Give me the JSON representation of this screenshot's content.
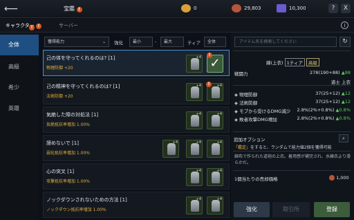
{
  "header": {
    "title": "宝鑑",
    "gold": "0",
    "silver": "29,803",
    "gem": "10,300",
    "help": "?",
    "close": "X"
  },
  "subtabs": [
    "キャラクター",
    "サーバー"
  ],
  "sidebar": [
    "全体",
    "高級",
    "希少",
    "英雄"
  ],
  "filters": {
    "ability": "獲得能力",
    "reinforce_label": "強化",
    "min": "最小",
    "max": "最大",
    "tier_label": "ティア",
    "tier_value": "全体"
  },
  "rows": [
    {
      "name": "己の体を守ってくれるのは? [1]",
      "desc": "物理防御 +20"
    },
    {
      "name": "己の精神を守ってくれるのは? [1]",
      "desc": "法術防御 +20"
    },
    {
      "name": "気絶した際の対処法 [1]",
      "desc": "気絶抵抗率増加 1.00%"
    },
    {
      "name": "諦めないで [1]",
      "desc": "弱化抵抗率増加 1.00%"
    },
    {
      "name": "心の突叉 [1]",
      "desc": "攻撃抵抗率増加 1.00%"
    },
    {
      "name": "ノックダウンされないための方法 [1]",
      "desc": "ノックダウン抵抗率増加 1.00%"
    }
  ],
  "detail": {
    "search_placeholder": "アイテム名を検索してください",
    "item_name": "綿(上衣)",
    "tier_tag": "1ティア",
    "grade_tag": "高級",
    "power_label": "戦闘力",
    "power_value": "278(190+88)",
    "power_up": "▲88",
    "type": "道士 上衣",
    "stats": [
      {
        "label": "物理防御",
        "value": "37(25+12)",
        "up": "▲12"
      },
      {
        "label": "法術防御",
        "value": "37(25+12)",
        "up": "▲12"
      },
      {
        "label": "モブから受けるDMG減少",
        "value": "2.8%(2%+0.8%)",
        "up": "▲0.8%"
      },
      {
        "label": "敗者攻撃DMG増加",
        "value": "2.8%(2%+0.8%)",
        "up": "▲0.8%"
      }
    ],
    "option_title": "追加オプション",
    "option_desc_hl": "「鑑定」",
    "option_desc": "をすると、ランダムで能力値2個を獲得可能",
    "flavor": "綿布で作られた道袍の上衣。着用感が補完され、水練衣より滑らかだ。",
    "price_label": "1個当たりの売却価格",
    "price_value": "1,000"
  },
  "buttons": {
    "reinforce": "強化",
    "cancel": "取引所",
    "register": "登録"
  }
}
